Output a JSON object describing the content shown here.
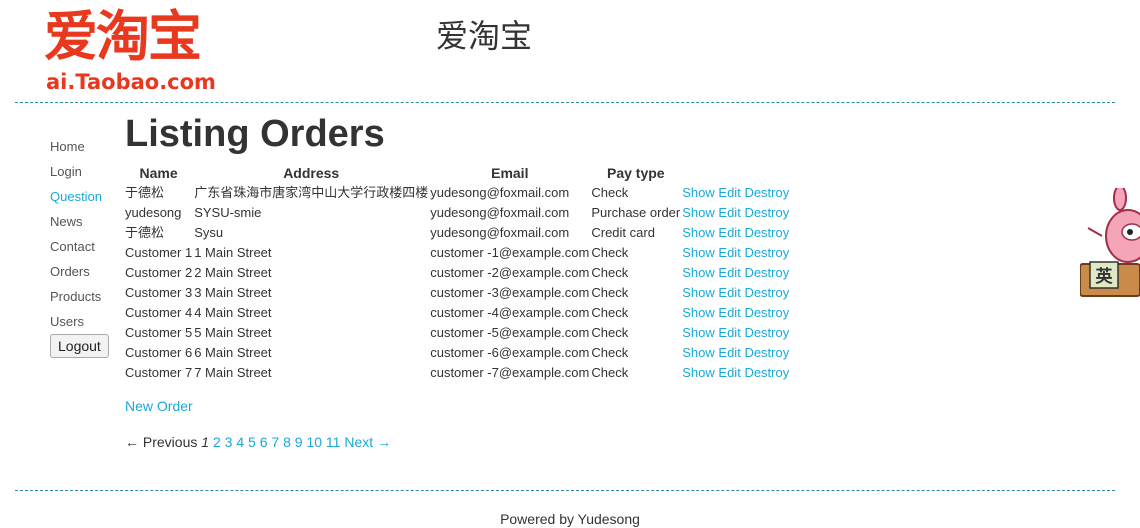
{
  "header": {
    "logo_cn": "爱淘宝",
    "logo_en": "ai.Taobao.com",
    "site_title": "爱淘宝"
  },
  "nav": {
    "items": [
      {
        "label": "Home"
      },
      {
        "label": "Login"
      },
      {
        "label": "Question"
      },
      {
        "label": "News"
      },
      {
        "label": "Contact"
      },
      {
        "label": "Orders"
      },
      {
        "label": "Products"
      },
      {
        "label": "Users"
      }
    ],
    "active": "Question",
    "logout_label": "Logout"
  },
  "main": {
    "title": "Listing Orders",
    "columns": [
      "Name",
      "Address",
      "Email",
      "Pay type"
    ],
    "rows": [
      {
        "name": "于德松",
        "address": "广东省珠海市唐家湾中山大学行政楼四楼",
        "email": "yudesong@foxmail.com",
        "pay_type": "Check"
      },
      {
        "name": "yudesong",
        "address": "SYSU-smie",
        "email": "yudesong@foxmail.com",
        "pay_type": "Purchase order"
      },
      {
        "name": "于德松",
        "address": "Sysu",
        "email": "yudesong@foxmail.com",
        "pay_type": "Credit card"
      },
      {
        "name": "Customer 1",
        "address": "1 Main Street",
        "email": "customer -1@example.com",
        "pay_type": "Check"
      },
      {
        "name": "Customer 2",
        "address": "2 Main Street",
        "email": "customer -2@example.com",
        "pay_type": "Check"
      },
      {
        "name": "Customer 3",
        "address": "3 Main Street",
        "email": "customer -3@example.com",
        "pay_type": "Check"
      },
      {
        "name": "Customer 4",
        "address": "4 Main Street",
        "email": "customer -4@example.com",
        "pay_type": "Check"
      },
      {
        "name": "Customer 5",
        "address": "5 Main Street",
        "email": "customer -5@example.com",
        "pay_type": "Check"
      },
      {
        "name": "Customer 6",
        "address": "6 Main Street",
        "email": "customer -6@example.com",
        "pay_type": "Check"
      },
      {
        "name": "Customer 7",
        "address": "7 Main Street",
        "email": "customer -7@example.com",
        "pay_type": "Check"
      }
    ],
    "actions": {
      "show": "Show",
      "edit": "Edit",
      "destroy": "Destroy"
    },
    "new_order_label": "New Order",
    "pagination": {
      "previous_label": "← Previous",
      "current_page": "1",
      "pages": [
        "2",
        "3",
        "4",
        "5",
        "6",
        "7",
        "8",
        "9",
        "10",
        "11"
      ],
      "next_label": "Next →"
    }
  },
  "footer": {
    "text": "Powered by Yudesong"
  },
  "mascot": {
    "badge_text": "英"
  },
  "colors": {
    "brand_red": "#e8381e",
    "link": "#1aa8d8",
    "rule": "#2a8aa8",
    "text": "#333333"
  }
}
